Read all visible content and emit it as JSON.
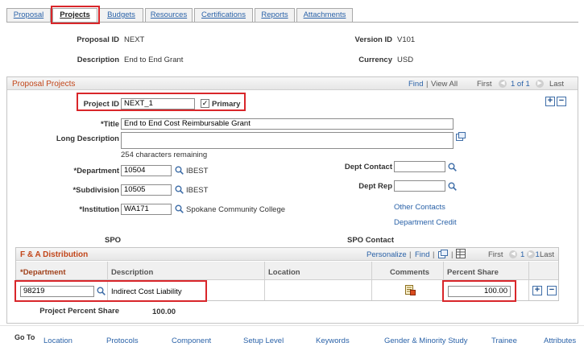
{
  "tabs": [
    {
      "label": "Proposal",
      "active": false
    },
    {
      "label": "Projects",
      "active": true
    },
    {
      "label": "Budgets",
      "active": false
    },
    {
      "label": "Resources",
      "active": false
    },
    {
      "label": "Certifications",
      "active": false
    },
    {
      "label": "Reports",
      "active": false
    },
    {
      "label": "Attachments",
      "active": false
    }
  ],
  "header": {
    "proposal_id_label": "Proposal ID",
    "proposal_id": "NEXT",
    "version_id_label": "Version ID",
    "version_id": "V101",
    "description_label": "Description",
    "description": "End to End Grant",
    "currency_label": "Currency",
    "currency": "USD"
  },
  "proposal_projects": {
    "title": "Proposal Projects",
    "find": "Find",
    "separator": "|",
    "view_all": "View All",
    "first": "First",
    "range": "1 of 1",
    "last": "Last",
    "project_id_label": "Project ID",
    "project_id": "NEXT_1",
    "primary_label": "Primary",
    "primary_checked": true,
    "title_label": "*Title",
    "title_value": "End to End Cost Reimbursable Grant",
    "long_description_label": "Long Description",
    "long_description": "",
    "chars_remaining": "254 characters remaining",
    "department_label": "*Department",
    "department": "10504",
    "department_desc": "IBEST",
    "subdivision_label": "*Subdivision",
    "subdivision": "10505",
    "subdivision_desc": "IBEST",
    "institution_label": "*Institution",
    "institution": "WA171",
    "institution_desc": "Spokane Community College",
    "dept_contact_label": "Dept Contact",
    "dept_contact": "",
    "dept_rep_label": "Dept Rep",
    "dept_rep": "",
    "other_contacts": "Other Contacts",
    "department_credit": "Department Credit",
    "spo_label": "SPO",
    "spo_contact_label": "SPO Contact"
  },
  "fa_distribution": {
    "title": "F & A Distribution",
    "personalize": "Personalize",
    "find": "Find",
    "first": "First",
    "range": "1 of 1",
    "last": "Last",
    "columns": [
      "*Department",
      "Description",
      "Location",
      "Comments",
      "Percent Share"
    ],
    "rows": [
      {
        "department": "98219",
        "description": "Indirect Cost Liability",
        "location": "",
        "percent_share": "100.00"
      }
    ]
  },
  "project_percent_share_label": "Project Percent Share",
  "project_percent_share": "100.00",
  "goto": {
    "label": "Go To",
    "links": [
      "Location",
      "Protocols",
      "Component",
      "Setup Level",
      "Keywords",
      "Gender & Minority Study",
      "Trainee",
      "Attributes"
    ]
  },
  "colors": {
    "accent_title": "#c2461a",
    "link": "#2a62a8",
    "highlight": "#d9262a"
  }
}
